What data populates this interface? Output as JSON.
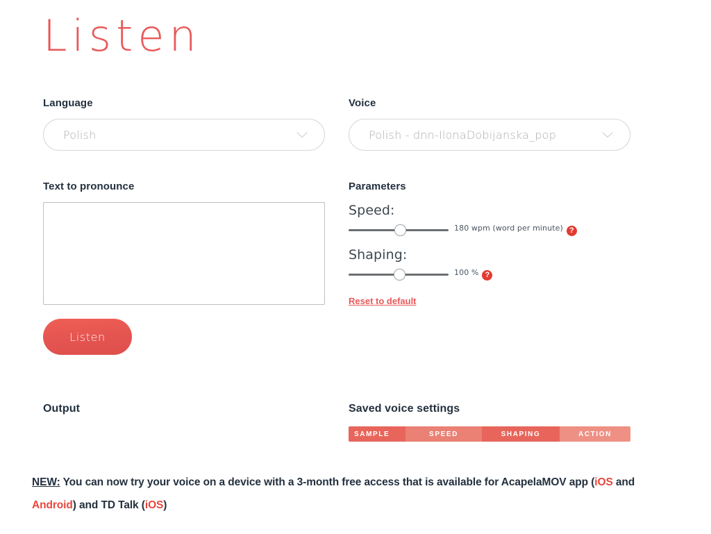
{
  "page": {
    "title": "Listen",
    "accent_color": "#e8595a",
    "text_color": "#23303e"
  },
  "language": {
    "label": "Language",
    "value": "Polish",
    "placeholder": "Polish",
    "chevron_icon": "chevron-down-icon"
  },
  "voice": {
    "label": "Voice",
    "value": "Polish - dnn-IlonaDobijanska_pop",
    "placeholder": "Polish - dnn-IlonaDobijanska_pop",
    "chevron_icon": "chevron-down-icon"
  },
  "text_to_pronounce": {
    "label": "Text to pronounce",
    "value": "",
    "placeholder": ""
  },
  "listen_button": {
    "label": "Listen"
  },
  "parameters": {
    "heading": "Parameters",
    "speed": {
      "label": "Speed:",
      "caption": "180 wpm (word per minute)",
      "value": 180,
      "percent": 52,
      "help_icon": "question-mark-icon",
      "help_label": "?"
    },
    "shaping": {
      "label": "Shaping:",
      "caption": "100 %",
      "value": 100,
      "percent": 51,
      "help_icon": "question-mark-icon",
      "help_label": "?"
    },
    "reset_link": "Reset to default"
  },
  "output": {
    "heading": "Output"
  },
  "saved_voice_settings": {
    "heading": "Saved voice settings",
    "columns": [
      "SAMPLE",
      "SPEED",
      "SHAPING",
      "ACTION"
    ],
    "rows": []
  },
  "footer": {
    "new_tag": "NEW:",
    "text_1": " You can now try your voice on a device with a 3-month free access that is available for AcapelaMOV app (",
    "link_1": "iOS",
    "text_2": " and ",
    "link_2": "Android",
    "text_3": ") and TD Talk (",
    "link_3": "iOS",
    "text_4": ")"
  }
}
